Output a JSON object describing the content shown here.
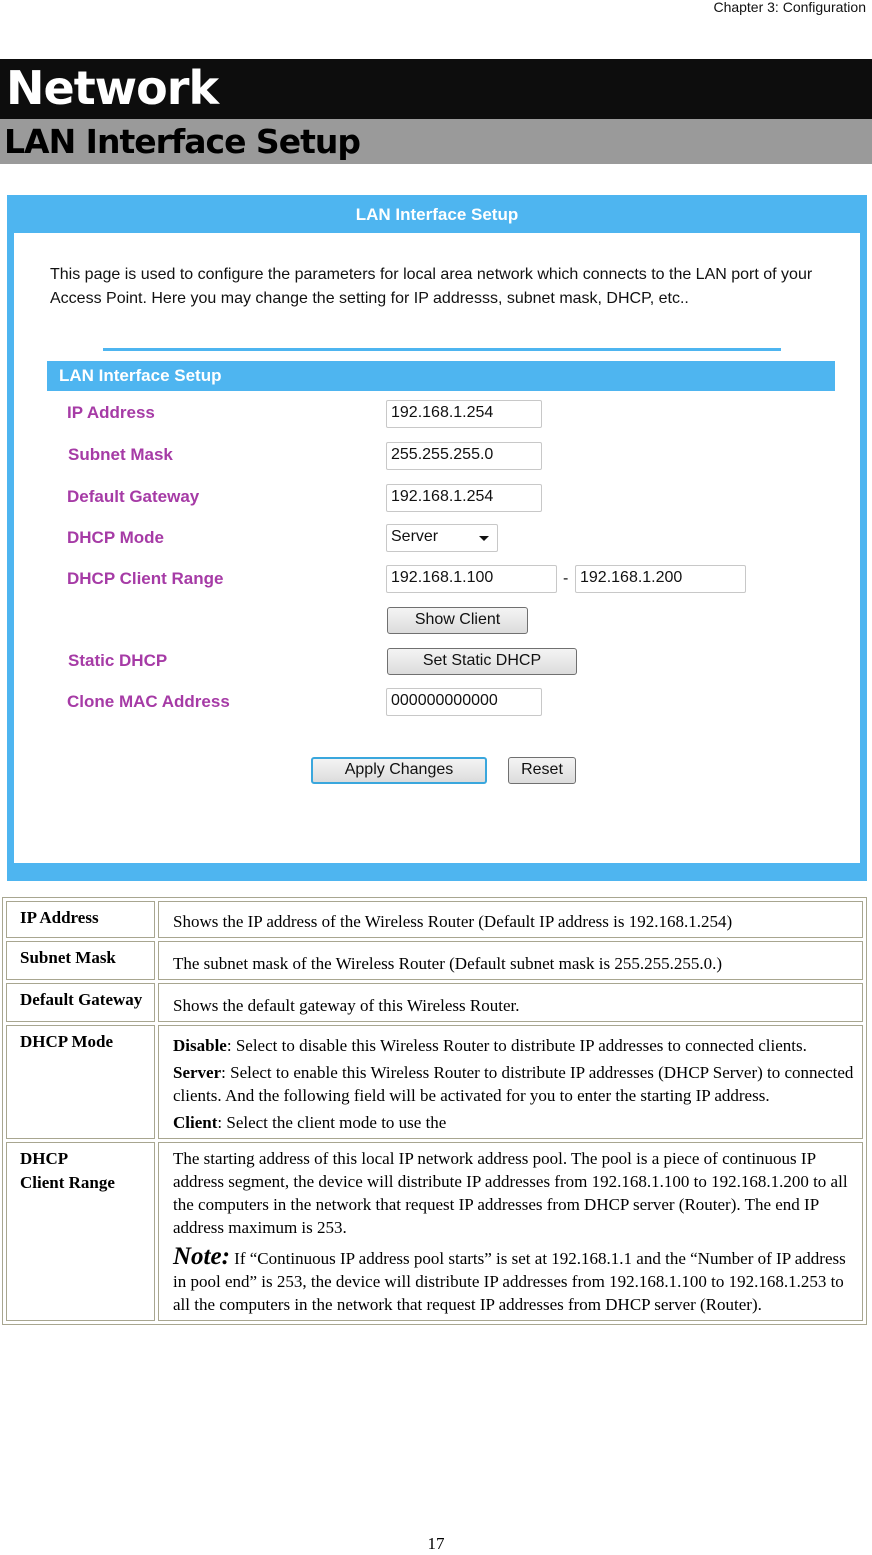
{
  "header": {
    "chapter": "Chapter 3: Configuration"
  },
  "titles": {
    "section": "Network",
    "subsection": "LAN Interface Setup"
  },
  "screenshot": {
    "panel_title": "LAN Interface Setup",
    "intro": "This page is used to configure the parameters for local area network which connects to the LAN port of your Access Point. Here you may change the setting for IP addresss, subnet mask, DHCP, etc..",
    "section_bar": "LAN Interface Setup",
    "fields": {
      "ip_address": {
        "label": "IP Address",
        "value": "192.168.1.254"
      },
      "subnet_mask": {
        "label": "Subnet Mask",
        "value": "255.255.255.0"
      },
      "default_gateway": {
        "label": "Default Gateway",
        "value": "192.168.1.254"
      },
      "dhcp_mode": {
        "label": "DHCP Mode",
        "value": "Server"
      },
      "dhcp_client_range": {
        "label": "DHCP Client Range",
        "start": "192.168.1.100",
        "separator": "-",
        "end": "192.168.1.200"
      },
      "static_dhcp": {
        "label": "Static DHCP"
      },
      "clone_mac": {
        "label": "Clone MAC Address",
        "value": "000000000000"
      }
    },
    "buttons": {
      "show_client": "Show Client",
      "set_static_dhcp": "Set Static DHCP",
      "apply": "Apply Changes",
      "reset": "Reset"
    },
    "colors": {
      "accent": "#4eb5f0",
      "label": "#a63ba6"
    }
  },
  "table": {
    "rows": [
      {
        "key": "IP Address",
        "text": "Shows the IP address of the Wireless Router (Default IP address is 192.168.1.254)"
      },
      {
        "key": "Subnet Mask",
        "text": "The subnet mask of the Wireless Router (Default subnet mask is 255.255.255.0.)"
      },
      {
        "key": "Default Gateway",
        "text": "Shows the default gateway of this Wireless Router."
      },
      {
        "key": "DHCP Mode",
        "items": [
          {
            "term": "Disable",
            "text": ": Select to disable this Wireless Router to distribute IP addresses to connected clients."
          },
          {
            "term": "Server",
            "text": ": Select to enable this Wireless Router to distribute IP addresses (DHCP Server) to connected clients. And the following field will be activated for you to enter the starting IP address."
          },
          {
            "term": "Client",
            "text": ": Select the client mode to use the"
          }
        ]
      },
      {
        "key_line1": "DHCP",
        "key_line2": "Client Range",
        "text": "The starting address of this local IP network address pool. The pool is a piece of continuous IP address segment, the device will distribute IP addresses from 192.168.1.100 to 192.168.1.200 to all the computers in the network that request IP addresses from DHCP server (Router). The end IP address maximum is  253.",
        "note_label": "Note:",
        "note_text": " If “Continuous IP address pool starts” is set at 192.168.1.1 and the “Number of IP address in pool end” is 253, the device will distribute IP addresses from 192.168.1.100 to 192.168.1.253 to all the computers in the network that request IP addresses from DHCP server (Router)."
      }
    ]
  },
  "footer": {
    "page_number": "17"
  }
}
